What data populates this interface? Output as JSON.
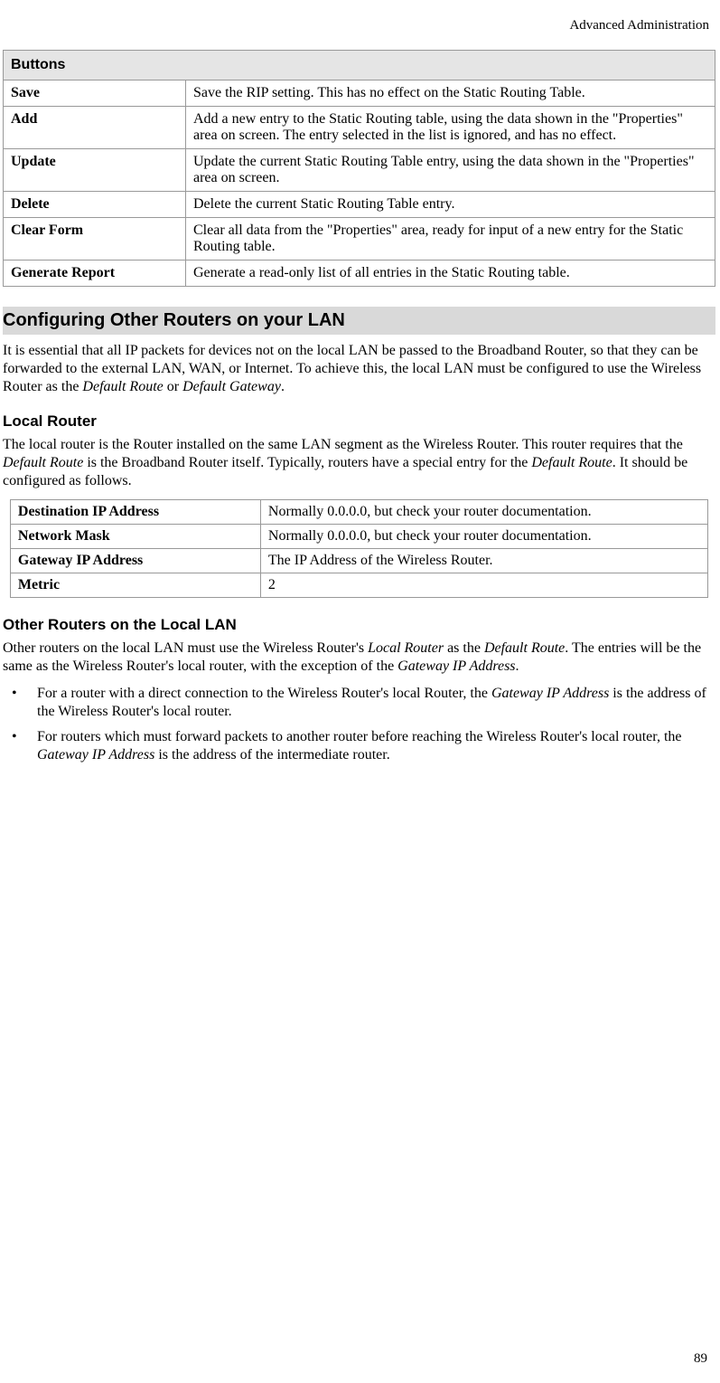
{
  "header": {
    "sectionName": "Advanced Administration"
  },
  "buttonsTable": {
    "title": "Buttons",
    "rows": [
      {
        "name": "Save",
        "desc": "Save the RIP setting. This has no effect on the Static Routing Table."
      },
      {
        "name": "Add",
        "desc": "Add a new entry to the Static Routing table, using the data shown in the \"Properties\" area on screen. The entry selected in the list is ignored, and has no effect."
      },
      {
        "name": "Update",
        "desc": "Update the current Static Routing Table entry, using the data shown in the \"Properties\" area on screen."
      },
      {
        "name": "Delete",
        "desc": "Delete the current Static Routing Table entry."
      },
      {
        "name": "Clear Form",
        "desc": "Clear all data from the \"Properties\" area, ready for input of a new entry for the Static Routing table."
      },
      {
        "name": "Generate Report",
        "desc": "Generate a read-only list of all entries in the Static Routing table."
      }
    ]
  },
  "section1": {
    "title": "Configuring Other Routers on your LAN",
    "intro_pre": "It is essential that all IP packets for devices not on the local LAN be passed to the Broadband Router, so that they can be forwarded to the external LAN, WAN, or Internet. To achieve this, the local LAN must be configured to use the Wireless Router as the ",
    "intro_em1": "Default Route",
    "intro_mid": " or ",
    "intro_em2": "Default Gateway",
    "intro_post": "."
  },
  "localRouter": {
    "title": "Local Router",
    "p1_pre": "The local router is the Router installed on the same LAN segment as the Wireless Router. This router requires that the ",
    "p1_em1": "Default Route",
    "p1_mid": " is the Broadband Router itself. Typically, routers have a special entry for the ",
    "p1_em2": "Default Route",
    "p1_post": ". It should be configured as follows.",
    "config": [
      {
        "label": "Destination IP Address",
        "value": "Normally 0.0.0.0, but check your router documentation."
      },
      {
        "label": "Network Mask",
        "value": "Normally 0.0.0.0, but check your router documentation."
      },
      {
        "label": "Gateway IP Address",
        "value": "The IP Address of the Wireless Router."
      },
      {
        "label": "Metric",
        "value": "2"
      }
    ]
  },
  "otherRouters": {
    "title": "Other Routers on the Local LAN",
    "p1_pre": "Other routers on the local LAN must use the Wireless Router's ",
    "p1_em1": "Local Router",
    "p1_mid1": " as the ",
    "p1_em2": "Default Route",
    "p1_mid2": ". The entries will be the same as the Wireless Router's local router, with the exception of the ",
    "p1_em3": "Gateway IP Address",
    "p1_post": ".",
    "bullets": [
      {
        "pre": "For a router with a direct connection to the Wireless Router's local Router, the ",
        "em": "Gateway IP Address",
        "post": " is the address of the Wireless Router's local router."
      },
      {
        "pre": "For routers which must forward packets to another router before reaching the Wireless Router's local router, the ",
        "em": "Gateway IP Address",
        "post": " is the address of the intermediate router."
      }
    ]
  },
  "pageNumber": "89"
}
